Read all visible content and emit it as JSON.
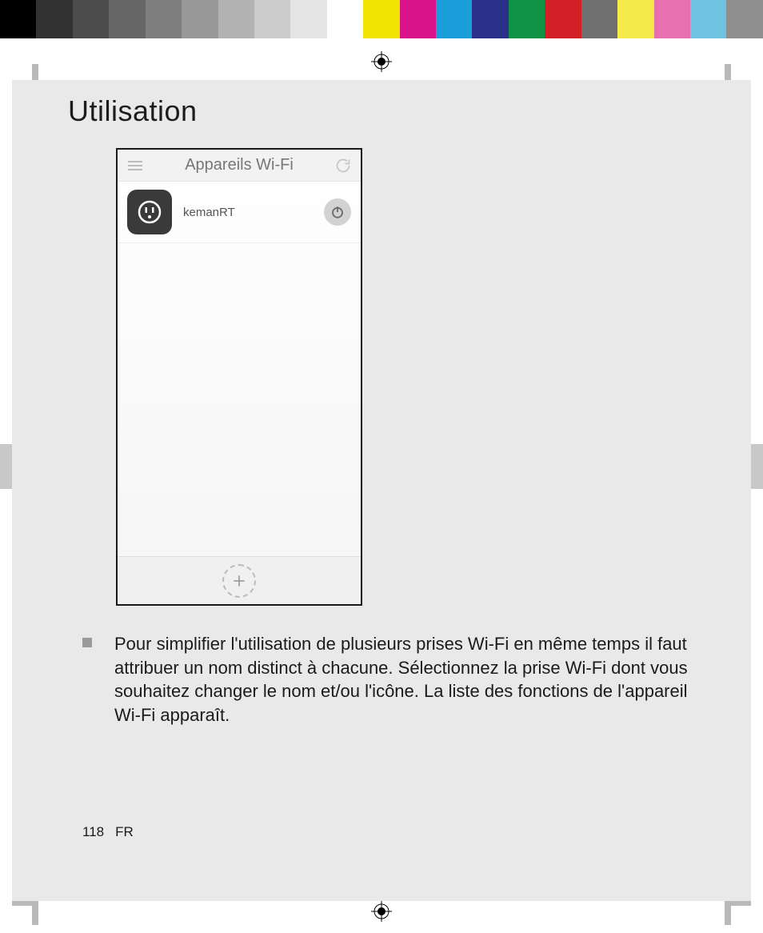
{
  "colorbar": [
    "#000000",
    "#323232",
    "#4c4c4c",
    "#666666",
    "#7f7f7f",
    "#999999",
    "#b2b2b2",
    "#cccccc",
    "#e5e5e5",
    "#ffffff",
    "#f0e400",
    "#d9138a",
    "#1a9dd9",
    "#2a2f87",
    "#0f9246",
    "#d11f25",
    "#6f6f6f",
    "#f4ea4a",
    "#e86fb0",
    "#6fc3e0",
    "#8f8f8f"
  ],
  "page": {
    "title": "Utilisation",
    "page_number": "118",
    "language": "FR"
  },
  "phone": {
    "header_title": "Appareils Wi-Fi",
    "device": {
      "name": "kemanRT"
    }
  },
  "body": {
    "bullet_text": "Pour simplifier l'utilisation de plusieurs prises Wi-Fi en même temps il faut attribuer un nom distinct à chacune. Sélectionnez la prise Wi-Fi dont vous souhaitez changer le nom et/ou l'icône. La liste des fonctions de l'appareil Wi-Fi apparaît."
  }
}
